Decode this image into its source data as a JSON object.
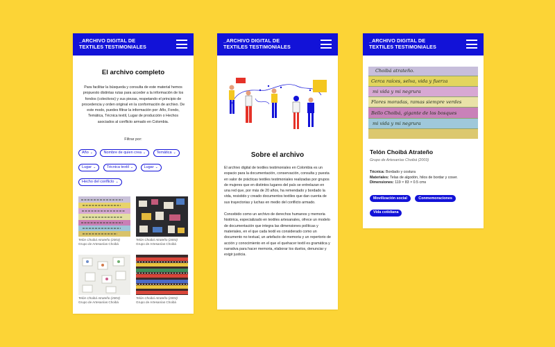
{
  "header": {
    "title_line1": "_ARCHIVO DIGITAL DE",
    "title_line2": "TEXTILES TESTIMONIALES"
  },
  "screen1": {
    "heading": "El archivo completo",
    "intro": "Para facilitar la búsqueda y consulta de este material hemos propuesto distintas rutas para acceder a la información de los fondos (colectivos) y sus piezas, respetando el principio de procedencia y orden original en la conformación de archivo. De este modo, puedes filtrar la información por: Año, Fondo, Temática, Técnica textil, Lugar de producción o Hechos asociados al conflicto armado en Colombia.",
    "filter_label": "Filtrar por:",
    "filters": [
      "Año",
      "Nombre de quien crea",
      "Temática",
      "Lugar",
      "Técnica textil",
      "Lugar",
      "Hecho del conflicto"
    ],
    "items": [
      {
        "title": "Telón Choibá Atrateño (2003)",
        "group": "Grupo de Artesanías Choibá"
      },
      {
        "title": "Telón Choibá Atrateño (2003)",
        "group": "Grupo de Artesanías Choibá"
      },
      {
        "title": "Telón Choibá Atrateño (2003)",
        "group": "Grupo de Artesanías Choibá"
      },
      {
        "title": "Telón Choibá Atrateño (2003)",
        "group": "Grupo de Artesanías Choibá"
      }
    ]
  },
  "screen2": {
    "heading": "Sobre el archivo",
    "para1": "El archivo digital de textiles testimoniales en Colombia es un espacio para la documentación, conservación, consulta y puesta en valor de prácticas textiles testimoniales realizadas por grupos de mujeres que en distintos lugares del país se entrelazan en una red que, por más de 20 años, ha remendado y bordado la vida, resistido y creado documentos textiles que dan cuenta de sus trayectorias y luchas en medio del conflicto armado.",
    "para2": "Concebido como un archivo de derechos humanos y memoria histórica, especializado en textiles artesanales, ofrece un modelo de documentación que integra las dimensiones políticas y materiales, en el que cada textil es considerado como un documento no textual, un artefacto de memoria y un repertorio de acción y conocimiento en el que el quehacer textil es gramática y narrativa para hacer memoria, elaborar los duelos, denunciar y exigir justicia."
  },
  "screen3": {
    "banner_lines": [
      "Choibá atrateño.",
      "Cerca raíces, selva, vida y fuerza",
      "mi vida y mi negrura",
      "Flores moradas, ramas siempre verdes",
      "Bello Choibá, gigante de los bosques",
      "mi vida y mi negrura"
    ],
    "title": "Telón Choibá Atrateño",
    "subtitle": "Grupo de Artesanías Choibá  (2003)",
    "tecnica_label": "Técnica:",
    "tecnica_value": "Bordado y costura",
    "materiales_label": "Materiales:",
    "materiales_value": "Telas de algodón, hilos de bordar y coser.",
    "dimensiones_label": "Dimensiones:",
    "dimensiones_value": "119 × 83 × 0.5 cms",
    "tags": [
      "Movilización social",
      "Conmemoraciones",
      "Vida cotidiana"
    ]
  },
  "colors": {
    "background": "#FCD436",
    "brand_blue": "#1212D8"
  },
  "icons": {
    "menu": "hamburger-menu-icon",
    "filter_chevron": "chevron-down-icon"
  }
}
